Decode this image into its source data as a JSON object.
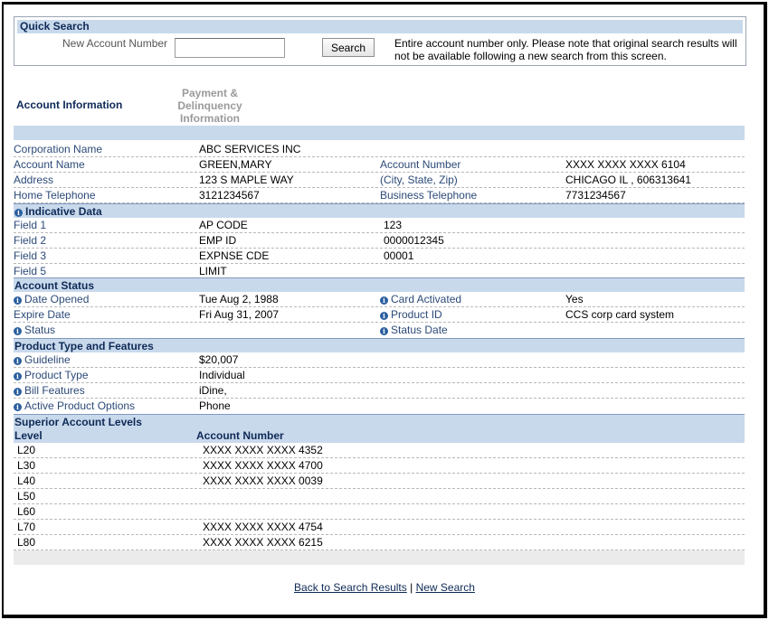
{
  "quick_search": {
    "title": "Quick Search",
    "label": "New Account Number",
    "input_value": "",
    "button": "Search",
    "note": "Entire account number only. Please note that original search results will not be available following a new search from this screen."
  },
  "tabs": {
    "active": "Account Information",
    "inactive_line1": "Payment &",
    "inactive_line2": "Delinquency",
    "inactive_line3": "Information"
  },
  "account": {
    "corp_label": "Corporation Name",
    "corp_value": "ABC SERVICES INC",
    "name_label": "Account Name",
    "name_value": "GREEN,MARY",
    "acctnum_label": "Account Number",
    "acctnum_value": "XXXX XXXX XXXX 6104",
    "address_label": "Address",
    "address_value": "123 S MAPLE WAY",
    "csz_label": "(City, State, Zip)",
    "csz_value": "CHICAGO IL , 606313641",
    "home_label": "Home Telephone",
    "home_value": "3121234567",
    "biz_label": "Business Telephone",
    "biz_value": "7731234567"
  },
  "indicative": {
    "title": "Indicative Data",
    "rows": [
      {
        "field": "Field  1",
        "code": "AP CODE",
        "value": "123"
      },
      {
        "field": "Field  2",
        "code": "EMP ID",
        "value": "0000012345"
      },
      {
        "field": "Field  3",
        "code": "EXPNSE CDE",
        "value": "00001"
      },
      {
        "field": "Field  5",
        "code": "LIMIT",
        "value": ""
      }
    ]
  },
  "status": {
    "title": "Account Status",
    "opened_label": "Date Opened",
    "opened_value": "Tue Aug 2, 1988",
    "activated_label": "Card Activated",
    "activated_value": "Yes",
    "expire_label": "Expire Date",
    "expire_value": "Fri Aug 31, 2007",
    "product_label": "Product ID",
    "product_value": "CCS corp card system",
    "status_label": "Status",
    "status_date_label": "Status Date"
  },
  "product": {
    "title": "Product Type and Features",
    "guideline_label": "Guideline",
    "guideline_value": "$20,007",
    "type_label": "Product Type",
    "type_value": "Individual",
    "bill_label": "Bill Features",
    "bill_value": "iDine,",
    "options_label": "Active Product Options",
    "options_value": "Phone"
  },
  "superior": {
    "title": "Superior Account Levels",
    "col_level": "Level",
    "col_account": "Account Number",
    "rows": [
      {
        "level": "L20",
        "account": "XXXX XXXX XXXX 4352"
      },
      {
        "level": "L30",
        "account": "XXXX XXXX XXXX 4700"
      },
      {
        "level": "L40",
        "account": "XXXX XXXX XXXX 0039"
      },
      {
        "level": "L50",
        "account": ""
      },
      {
        "level": "L60",
        "account": ""
      },
      {
        "level": "L70",
        "account": "XXXX XXXX XXXX 4754"
      },
      {
        "level": "L80",
        "account": "XXXX XXXX XXXX 6215"
      }
    ]
  },
  "footer": {
    "back": "Back to Search Results",
    "sep": "|",
    "new": "New Search"
  }
}
